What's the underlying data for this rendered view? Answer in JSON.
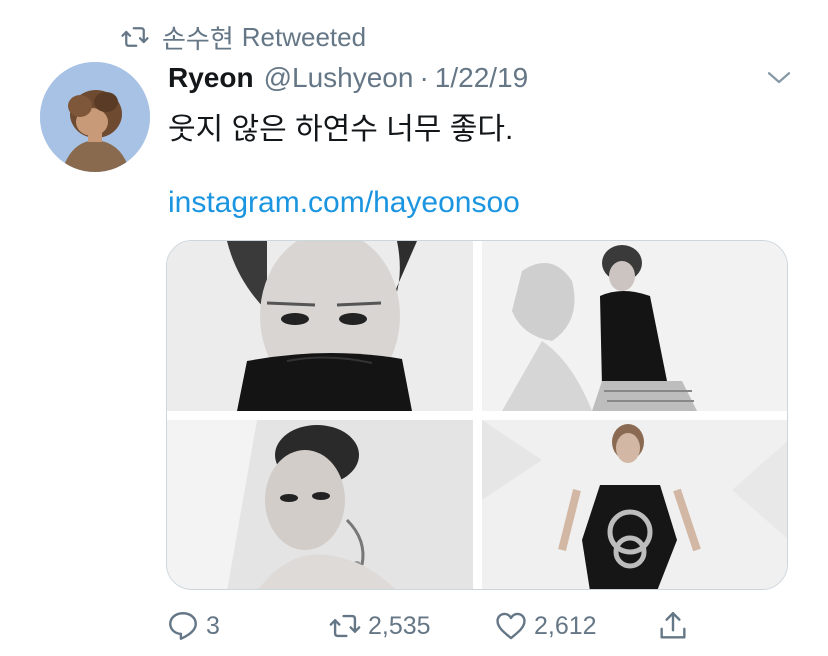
{
  "retweet_banner": {
    "user": "손수현",
    "label": "Retweeted",
    "icon": "retweet-icon"
  },
  "tweet": {
    "display_name": "Ryeon",
    "handle": "@Lushyeon",
    "separator": "·",
    "date": "1/22/19",
    "text": "웃지 않은 하연수 너무 좋다.",
    "link": "instagram.com/hayeonsoo",
    "media_count": 4
  },
  "actions": {
    "replies": "3",
    "retweets": "2,535",
    "likes": "2,612"
  },
  "colors": {
    "link": "#1b95e0",
    "secondary_text": "#657786",
    "primary_text": "#14171a",
    "border": "#ccd6dd"
  }
}
